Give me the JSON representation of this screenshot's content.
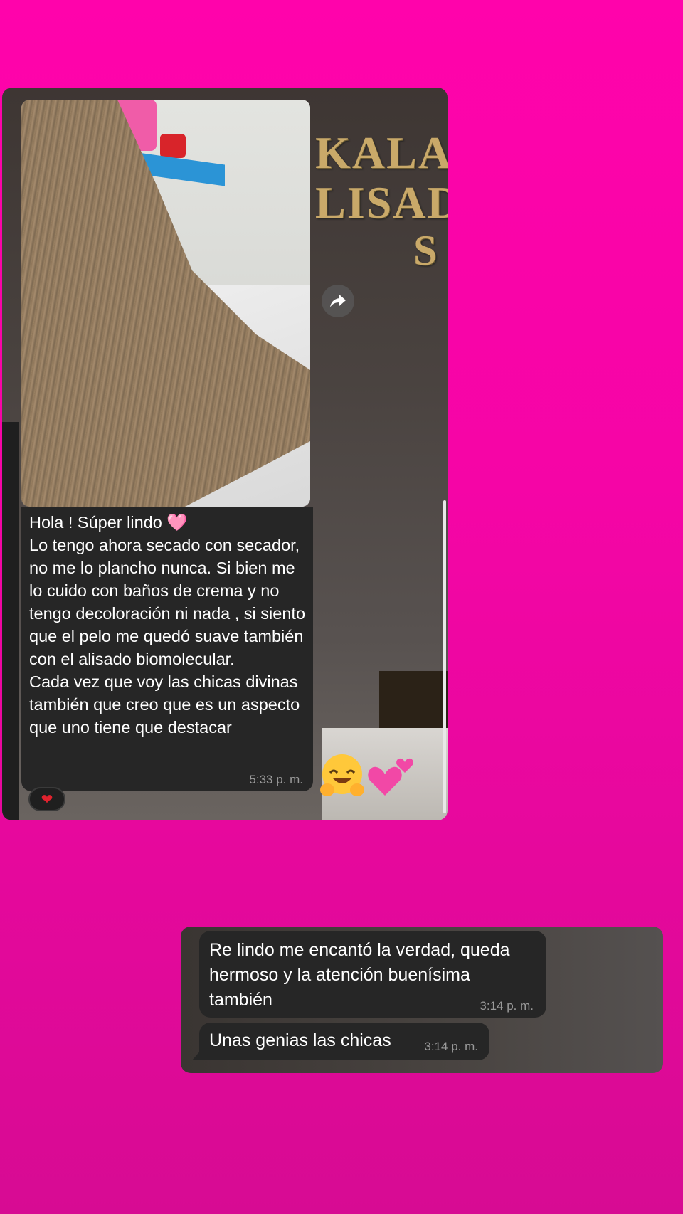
{
  "background": {
    "color_top": "#ff03ab",
    "color_bottom": "#d70b93"
  },
  "screenshot_1": {
    "sign_text": [
      "KALA",
      "LISAD",
      "S"
    ],
    "photo": {
      "description_icon": "hair-photo"
    },
    "share_button": {
      "icon": "share-forward-icon"
    },
    "message": {
      "text": "Hola ! Súper lindo 🩷\nLo tengo ahora secado con secador, no me lo plancho nunca. Si bien me lo cuido con baños de crema y no tengo decoloración ni nada , si siento que el pelo me quedó suave también con el alisado biomolecular.\nCada vez que voy las chicas divinas también que creo que es un aspecto que uno tiene que destacar",
      "time": "5:33 p. m."
    },
    "reaction": {
      "emoji": "❤",
      "icon": "heart-reaction-icon"
    },
    "sticker_emojis": [
      "hugging-face-emoji",
      "two-hearts-emoji"
    ]
  },
  "screenshot_2": {
    "messages": [
      {
        "text": "Re lindo me encantó la verdad, queda hermoso y la atención buenísima también",
        "time": "3:14 p. m."
      },
      {
        "text": "Unas genias las chicas",
        "time": "3:14 p. m."
      }
    ]
  }
}
